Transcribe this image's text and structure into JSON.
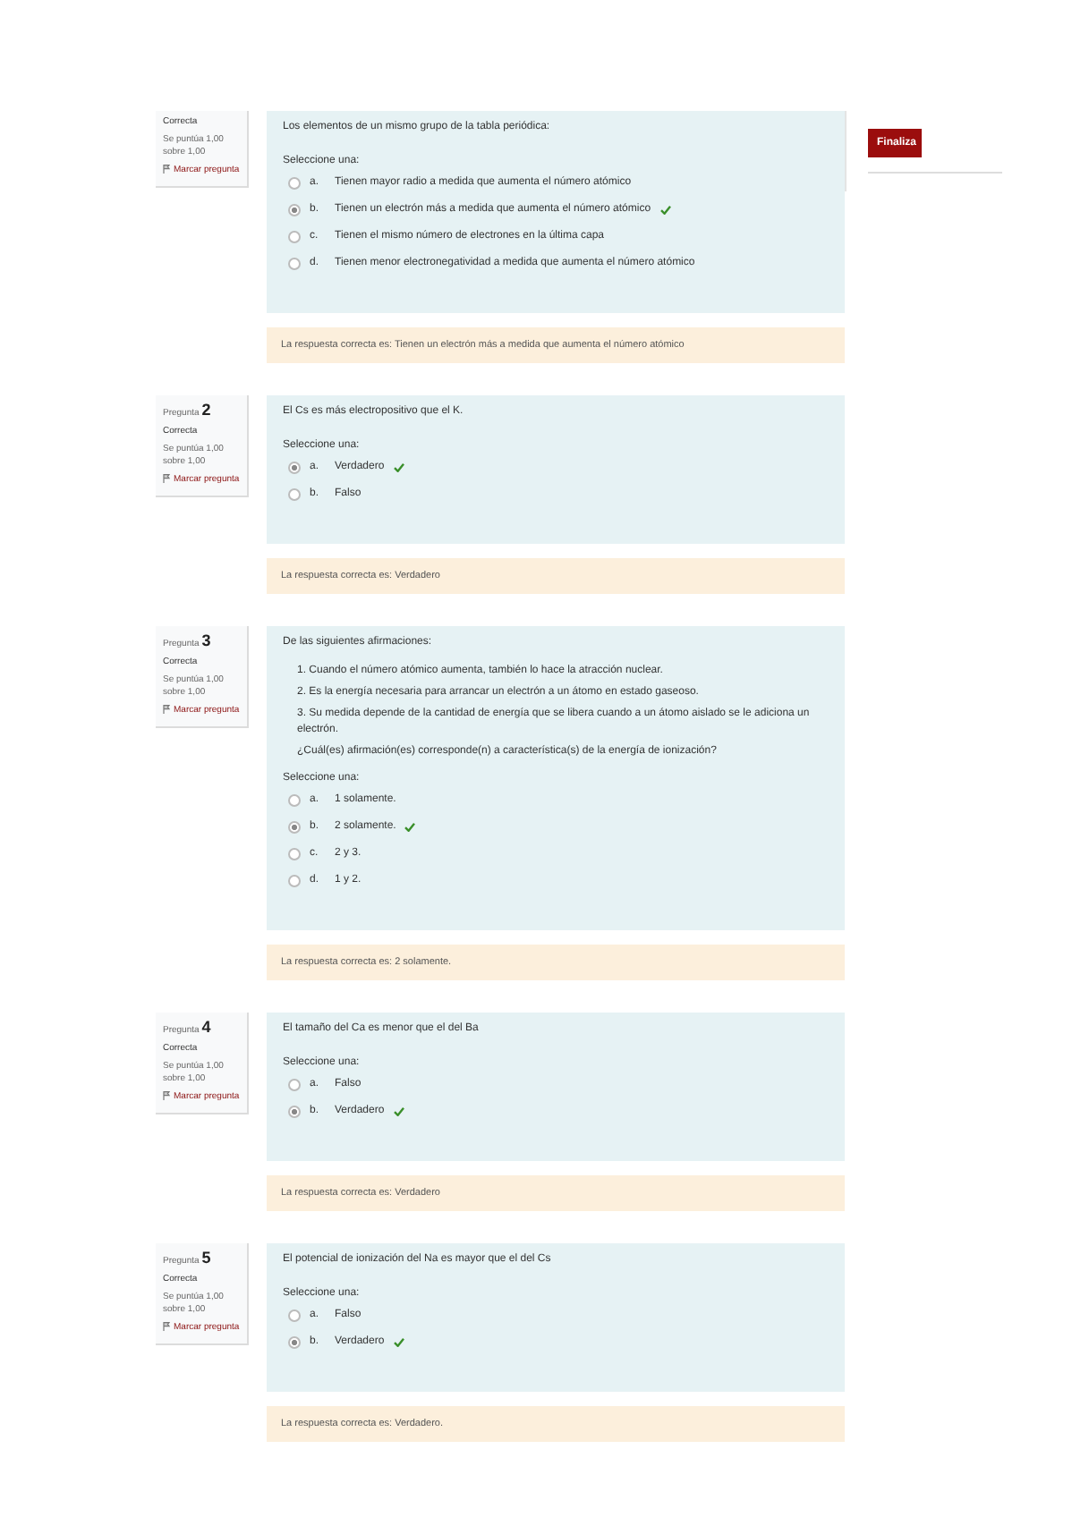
{
  "questions": [
    {
      "info": {
        "status": "Correcta",
        "score": "Se puntúa 1,00 sobre 1,00",
        "flag": "Marcar pregunta"
      },
      "text": "Los elementos de un mismo grupo de la tabla periódica:",
      "prompt": "Seleccione una:",
      "options": [
        {
          "letter": "a.",
          "text": "Tienen mayor radio a medida que aumenta el número atómico",
          "selected": false,
          "correct": false
        },
        {
          "letter": "b.",
          "text": "Tienen un electrón más a medida que aumenta el número atómico",
          "selected": true,
          "correct": true
        },
        {
          "letter": "c.",
          "text": "Tienen el mismo número de electrones en la última capa",
          "selected": false,
          "correct": false
        },
        {
          "letter": "d.",
          "text": "Tienen menor electronegatividad a medida que aumenta el número atómico",
          "selected": false,
          "correct": false
        }
      ],
      "feedback": "La respuesta correcta es: Tienen un electrón más a medida que aumenta el número atómico"
    },
    {
      "info": {
        "label": "Pregunta",
        "number": "2",
        "status": "Correcta",
        "score": "Se puntúa 1,00 sobre 1,00",
        "flag": "Marcar pregunta"
      },
      "text": "El Cs es más electropositivo que el K.",
      "prompt": "Seleccione una:",
      "options": [
        {
          "letter": "a.",
          "text": "Verdadero",
          "selected": true,
          "correct": true
        },
        {
          "letter": "b.",
          "text": "Falso",
          "selected": false,
          "correct": false
        }
      ],
      "feedback": "La respuesta correcta es: Verdadero"
    },
    {
      "info": {
        "label": "Pregunta",
        "number": "3",
        "status": "Correcta",
        "score": "Se puntúa 1,00 sobre 1,00",
        "flag": "Marcar pregunta"
      },
      "text": "De las siguientes afirmaciones:",
      "statements": [
        "1.   Cuando el número atómico aumenta, también lo hace la atracción nuclear.",
        "2.   Es la energía necesaria para arrancar un electrón a un átomo en estado gaseoso.",
        "3.   Su medida depende de la cantidad de energía que se libera cuando a un átomo aislado se le adiciona un electrón.",
        "¿Cuál(es) afirmación(es) corresponde(n) a característica(s) de la energía de ionización?"
      ],
      "prompt": "Seleccione una:",
      "options": [
        {
          "letter": "a.",
          "text": "1 solamente.",
          "selected": false,
          "correct": false
        },
        {
          "letter": "b.",
          "text": "2 solamente.",
          "selected": true,
          "correct": true
        },
        {
          "letter": "c.",
          "text": "2 y 3.",
          "selected": false,
          "correct": false
        },
        {
          "letter": "d.",
          "text": "1 y 2.",
          "selected": false,
          "correct": false
        }
      ],
      "feedback": "La respuesta correcta es: 2 solamente."
    },
    {
      "info": {
        "label": "Pregunta",
        "number": "4",
        "status": "Correcta",
        "score": "Se puntúa 1,00 sobre 1,00",
        "flag": "Marcar pregunta"
      },
      "text": "El tamaño del Ca es menor que el del Ba",
      "prompt": "Seleccione una:",
      "options": [
        {
          "letter": "a.",
          "text": "Falso",
          "selected": false,
          "correct": false
        },
        {
          "letter": "b.",
          "text": "Verdadero",
          "selected": true,
          "correct": true
        }
      ],
      "feedback": "La respuesta correcta es: Verdadero"
    },
    {
      "info": {
        "label": "Pregunta",
        "number": "5",
        "status": "Correcta",
        "score": "Se puntúa 1,00 sobre 1,00",
        "flag": "Marcar pregunta"
      },
      "text": "El potencial de ionización del Na es mayor que el del Cs",
      "prompt": "Seleccione una:",
      "options": [
        {
          "letter": "a.",
          "text": "Falso",
          "selected": false,
          "correct": false
        },
        {
          "letter": "b.",
          "text": "Verdadero",
          "selected": true,
          "correct": true
        }
      ],
      "feedback": "La respuesta correcta es: Verdadero."
    }
  ],
  "sidebar": {
    "button": "Finaliza"
  }
}
